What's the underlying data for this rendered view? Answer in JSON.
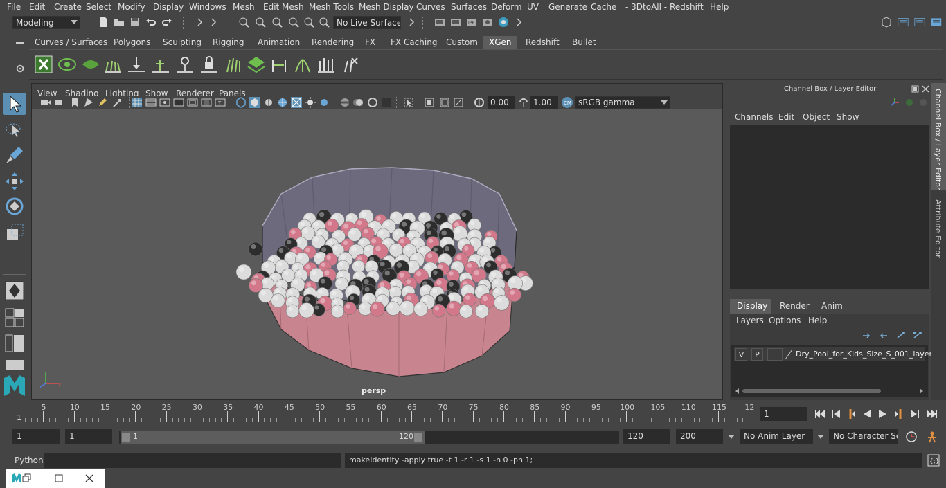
{
  "menu": [
    "File",
    "Edit",
    "Create",
    "Select",
    "Modify",
    "Display",
    "Windows",
    "Mesh",
    "Edit Mesh",
    "Mesh Tools",
    "Mesh Display",
    "Curves",
    "Surfaces",
    "Deform",
    "UV",
    "Generate",
    "Cache",
    "- 3DtoAll -",
    "Redshift",
    "Help"
  ],
  "status": {
    "mode": "Modeling",
    "live_surface": "No Live Surface"
  },
  "shelf_tabs": [
    "Curves / Surfaces",
    "Polygons",
    "Sculpting",
    "Rigging",
    "Animation",
    "Rendering",
    "FX",
    "FX Caching",
    "Custom",
    "XGen",
    "Redshift",
    "Bullet"
  ],
  "active_shelf": "XGen",
  "panel_menu": [
    "View",
    "Shading",
    "Lighting",
    "Show",
    "Renderer",
    "Panels"
  ],
  "viewport": {
    "exposure": "0.00",
    "gamma": "1.00",
    "color_space": "sRGB gamma",
    "camera_label": "persp"
  },
  "channel_box": {
    "title": "Channel Box / Layer Editor",
    "menu": [
      "Channels",
      "Edit",
      "Object",
      "Show"
    ]
  },
  "layer_editor": {
    "tabs": [
      "Display",
      "Render",
      "Anim"
    ],
    "active_tab": "Display",
    "menu": [
      "Layers",
      "Options",
      "Help"
    ],
    "layer": {
      "v": "V",
      "p": "P",
      "name": "Dry_Pool_for_Kids_Size_S_001_layer"
    }
  },
  "side_tabs": [
    "Channel Box / Layer Editor",
    "Attribute Editor"
  ],
  "timeline": {
    "ticks": [
      "5",
      "10",
      "15",
      "20",
      "25",
      "30",
      "35",
      "40",
      "45",
      "50",
      "55",
      "60",
      "65",
      "70",
      "75",
      "80",
      "85",
      "90",
      "95",
      "100",
      "105",
      "110",
      "115",
      "12"
    ],
    "current_marker": "1",
    "current_frame": "1"
  },
  "range": {
    "start": "1",
    "start2": "1",
    "slider_start": "1",
    "slider_end": "120",
    "end": "120",
    "end2": "200",
    "anim_layer": "No Anim Layer",
    "char_set": "No Character Set"
  },
  "cmd": {
    "lang": "Python",
    "output": "makeIdentity -apply true -t 1 -r 1 -s 1 -n 0 -pn 1;"
  },
  "colors": {
    "bg": "#444444",
    "viewport": "#5a5a5a",
    "pool_outer": "#c9848f",
    "pool_inner": "#6d6a7e",
    "ball_pink": "#d3788a",
    "ball_white": "#dcdcdc",
    "ball_dark": "#2d2d2d",
    "accent_blue": "#5d8fb8"
  }
}
